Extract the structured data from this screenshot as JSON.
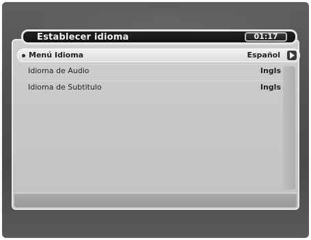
{
  "header": {
    "title": "Establecer idioma",
    "time": "01:17"
  },
  "settings": [
    {
      "label": "Menú Idioma",
      "value": "Español",
      "selected": true
    },
    {
      "label": "Idioma de Audio",
      "value": "Ingls",
      "selected": false
    },
    {
      "label": "Idioma de Subtitulo",
      "value": "Ingls",
      "selected": false
    }
  ],
  "icons": {
    "selector": "bullet-icon",
    "next": "right-arrow-icon"
  },
  "colors": {
    "panel": "#c8c8c8",
    "title_bar": "#111111",
    "highlight": "#e6e6e6",
    "text": "#1f1f1f"
  }
}
